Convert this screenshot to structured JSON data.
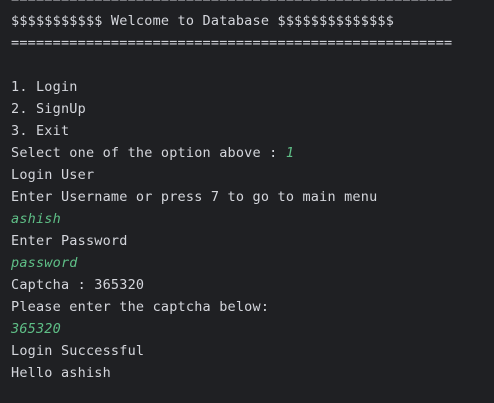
{
  "console": {
    "lines": [
      {
        "text": "=====================================================",
        "kind": "output"
      },
      {
        "text": "$$$$$$$$$$$ Welcome to Database $$$$$$$$$$$$$$",
        "kind": "output"
      },
      {
        "text": "=====================================================",
        "kind": "output"
      },
      {
        "text": "",
        "kind": "blank"
      },
      {
        "text": "1. Login",
        "kind": "output"
      },
      {
        "text": "2. SignUp",
        "kind": "output"
      },
      {
        "text": "3. Exit",
        "kind": "output"
      },
      {
        "text": "Select one of the option above : ",
        "kind": "prompt",
        "input": "1"
      },
      {
        "text": "Login User",
        "kind": "output"
      },
      {
        "text": "Enter Username or press 7 to go to main menu",
        "kind": "output"
      },
      {
        "text": "ashish",
        "kind": "input"
      },
      {
        "text": "Enter Password",
        "kind": "output"
      },
      {
        "text": "password",
        "kind": "input"
      },
      {
        "text": "Captcha : 365320",
        "kind": "output"
      },
      {
        "text": "Please enter the captcha below:",
        "kind": "output"
      },
      {
        "text": "365320",
        "kind": "input"
      },
      {
        "text": "Login Successful",
        "kind": "output"
      },
      {
        "text": "Hello ashish",
        "kind": "output"
      }
    ]
  },
  "colors": {
    "background": "#1f2023",
    "output_text": "#d4d6dc",
    "user_input": "#5fbf87"
  }
}
